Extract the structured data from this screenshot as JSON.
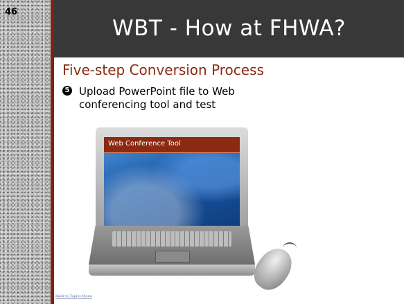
{
  "slide": {
    "number": "46",
    "title": "WBT - How at FHWA?",
    "heading": "Five-step Conversion Process",
    "bullet": {
      "marker": "5",
      "text": "Upload PowerPoint file to Web conferencing tool and test"
    },
    "laptop_screen": {
      "title": "Web Conference Tool"
    },
    "back_link": "Back to Topics Menu"
  },
  "colors": {
    "title_bar": "#383838",
    "accent": "#8b2a12",
    "divider": "#7b2511"
  }
}
